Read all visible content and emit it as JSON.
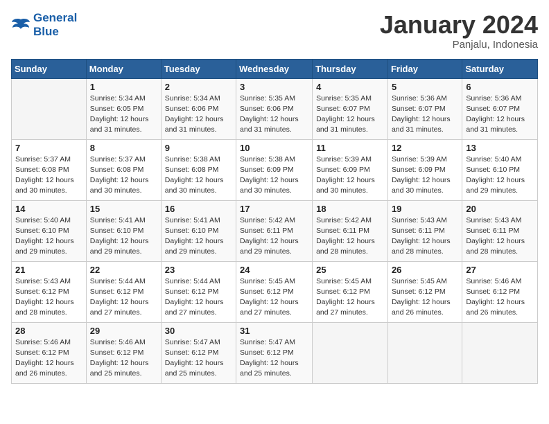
{
  "header": {
    "logo_line1": "General",
    "logo_line2": "Blue",
    "month": "January 2024",
    "location": "Panjalu, Indonesia"
  },
  "days_of_week": [
    "Sunday",
    "Monday",
    "Tuesday",
    "Wednesday",
    "Thursday",
    "Friday",
    "Saturday"
  ],
  "weeks": [
    [
      {
        "day": "",
        "info": ""
      },
      {
        "day": "1",
        "info": "Sunrise: 5:34 AM\nSunset: 6:05 PM\nDaylight: 12 hours\nand 31 minutes."
      },
      {
        "day": "2",
        "info": "Sunrise: 5:34 AM\nSunset: 6:06 PM\nDaylight: 12 hours\nand 31 minutes."
      },
      {
        "day": "3",
        "info": "Sunrise: 5:35 AM\nSunset: 6:06 PM\nDaylight: 12 hours\nand 31 minutes."
      },
      {
        "day": "4",
        "info": "Sunrise: 5:35 AM\nSunset: 6:07 PM\nDaylight: 12 hours\nand 31 minutes."
      },
      {
        "day": "5",
        "info": "Sunrise: 5:36 AM\nSunset: 6:07 PM\nDaylight: 12 hours\nand 31 minutes."
      },
      {
        "day": "6",
        "info": "Sunrise: 5:36 AM\nSunset: 6:07 PM\nDaylight: 12 hours\nand 31 minutes."
      }
    ],
    [
      {
        "day": "7",
        "info": "Sunrise: 5:37 AM\nSunset: 6:08 PM\nDaylight: 12 hours\nand 30 minutes."
      },
      {
        "day": "8",
        "info": "Sunrise: 5:37 AM\nSunset: 6:08 PM\nDaylight: 12 hours\nand 30 minutes."
      },
      {
        "day": "9",
        "info": "Sunrise: 5:38 AM\nSunset: 6:08 PM\nDaylight: 12 hours\nand 30 minutes."
      },
      {
        "day": "10",
        "info": "Sunrise: 5:38 AM\nSunset: 6:09 PM\nDaylight: 12 hours\nand 30 minutes."
      },
      {
        "day": "11",
        "info": "Sunrise: 5:39 AM\nSunset: 6:09 PM\nDaylight: 12 hours\nand 30 minutes."
      },
      {
        "day": "12",
        "info": "Sunrise: 5:39 AM\nSunset: 6:09 PM\nDaylight: 12 hours\nand 30 minutes."
      },
      {
        "day": "13",
        "info": "Sunrise: 5:40 AM\nSunset: 6:10 PM\nDaylight: 12 hours\nand 29 minutes."
      }
    ],
    [
      {
        "day": "14",
        "info": "Sunrise: 5:40 AM\nSunset: 6:10 PM\nDaylight: 12 hours\nand 29 minutes."
      },
      {
        "day": "15",
        "info": "Sunrise: 5:41 AM\nSunset: 6:10 PM\nDaylight: 12 hours\nand 29 minutes."
      },
      {
        "day": "16",
        "info": "Sunrise: 5:41 AM\nSunset: 6:10 PM\nDaylight: 12 hours\nand 29 minutes."
      },
      {
        "day": "17",
        "info": "Sunrise: 5:42 AM\nSunset: 6:11 PM\nDaylight: 12 hours\nand 29 minutes."
      },
      {
        "day": "18",
        "info": "Sunrise: 5:42 AM\nSunset: 6:11 PM\nDaylight: 12 hours\nand 28 minutes."
      },
      {
        "day": "19",
        "info": "Sunrise: 5:43 AM\nSunset: 6:11 PM\nDaylight: 12 hours\nand 28 minutes."
      },
      {
        "day": "20",
        "info": "Sunrise: 5:43 AM\nSunset: 6:11 PM\nDaylight: 12 hours\nand 28 minutes."
      }
    ],
    [
      {
        "day": "21",
        "info": "Sunrise: 5:43 AM\nSunset: 6:12 PM\nDaylight: 12 hours\nand 28 minutes."
      },
      {
        "day": "22",
        "info": "Sunrise: 5:44 AM\nSunset: 6:12 PM\nDaylight: 12 hours\nand 27 minutes."
      },
      {
        "day": "23",
        "info": "Sunrise: 5:44 AM\nSunset: 6:12 PM\nDaylight: 12 hours\nand 27 minutes."
      },
      {
        "day": "24",
        "info": "Sunrise: 5:45 AM\nSunset: 6:12 PM\nDaylight: 12 hours\nand 27 minutes."
      },
      {
        "day": "25",
        "info": "Sunrise: 5:45 AM\nSunset: 6:12 PM\nDaylight: 12 hours\nand 27 minutes."
      },
      {
        "day": "26",
        "info": "Sunrise: 5:45 AM\nSunset: 6:12 PM\nDaylight: 12 hours\nand 26 minutes."
      },
      {
        "day": "27",
        "info": "Sunrise: 5:46 AM\nSunset: 6:12 PM\nDaylight: 12 hours\nand 26 minutes."
      }
    ],
    [
      {
        "day": "28",
        "info": "Sunrise: 5:46 AM\nSunset: 6:12 PM\nDaylight: 12 hours\nand 26 minutes."
      },
      {
        "day": "29",
        "info": "Sunrise: 5:46 AM\nSunset: 6:12 PM\nDaylight: 12 hours\nand 25 minutes."
      },
      {
        "day": "30",
        "info": "Sunrise: 5:47 AM\nSunset: 6:12 PM\nDaylight: 12 hours\nand 25 minutes."
      },
      {
        "day": "31",
        "info": "Sunrise: 5:47 AM\nSunset: 6:12 PM\nDaylight: 12 hours\nand 25 minutes."
      },
      {
        "day": "",
        "info": ""
      },
      {
        "day": "",
        "info": ""
      },
      {
        "day": "",
        "info": ""
      }
    ]
  ]
}
